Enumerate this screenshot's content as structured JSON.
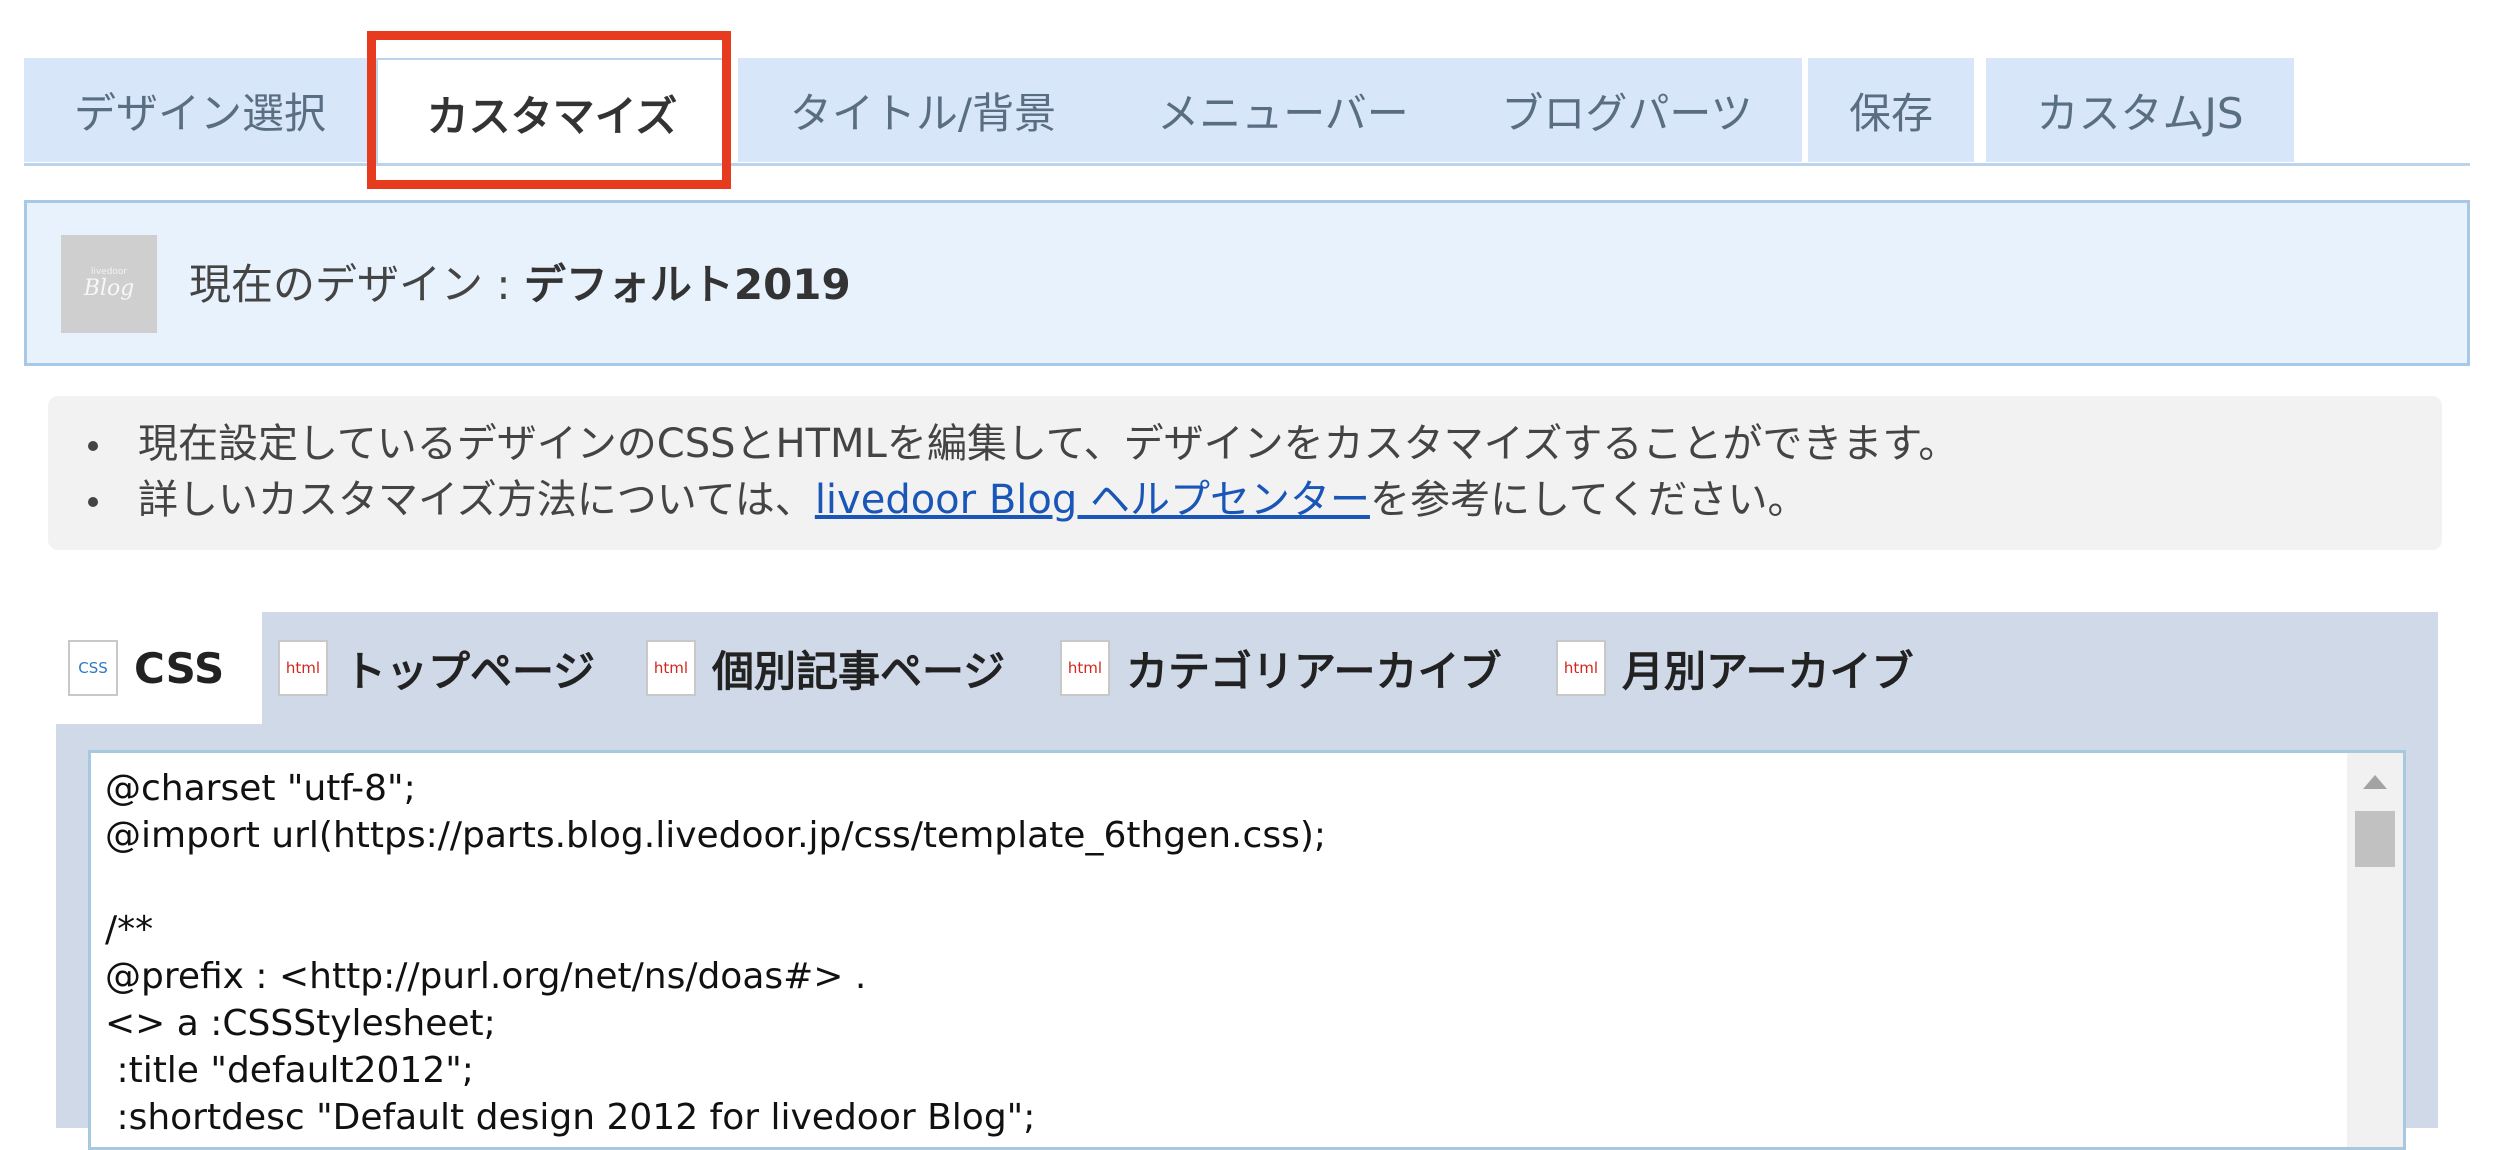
{
  "tabs": [
    {
      "label": "デザイン選択",
      "active": false
    },
    {
      "label": "カスタマイズ",
      "active": true
    },
    {
      "label": "タイトル/背景",
      "active": false
    },
    {
      "label": "メニューバー",
      "active": false
    },
    {
      "label": "ブログパーツ",
      "active": false
    },
    {
      "label": "保存",
      "active": false
    },
    {
      "label": "カスタムJS",
      "active": false
    }
  ],
  "current_design": {
    "thumb_small": "livedoor",
    "thumb_text": "Blog",
    "label": "現在のデザイン : ",
    "name": "デフォルト2019"
  },
  "notice": {
    "line1": "現在設定しているデザインのCSSとHTMLを編集して、デザインをカスタマイズすることができます。",
    "line2_before": "詳しいカスタマイズ方法については、",
    "line2_link": "livedoor Blog ヘルプセンター",
    "line2_after": "を参考にしてください。"
  },
  "editor": {
    "tabs": [
      {
        "label": "CSS",
        "icon_text": "CSS",
        "active": true
      },
      {
        "label": "トップページ",
        "icon_text": "html",
        "active": false
      },
      {
        "label": "個別記事ページ",
        "icon_text": "html",
        "active": false
      },
      {
        "label": "カテゴリアーカイブ",
        "icon_text": "html",
        "active": false
      },
      {
        "label": "月別アーカイブ",
        "icon_text": "html",
        "active": false
      }
    ],
    "code_lines": [
      "@charset \"utf-8\";",
      "@import url(https://parts.blog.livedoor.jp/css/template_6thgen.css);",
      "",
      "/**",
      "@prefix : <http://purl.org/net/ns/doas#> .",
      "<> a :CSSStylesheet;",
      " :title \"default2012\";",
      " :shortdesc \"Default design 2012 for livedoor Blog\";"
    ]
  },
  "colors": {
    "highlight": "#e63b1e",
    "tab_bg": "#d7e6f8",
    "link": "#1a56b8"
  }
}
